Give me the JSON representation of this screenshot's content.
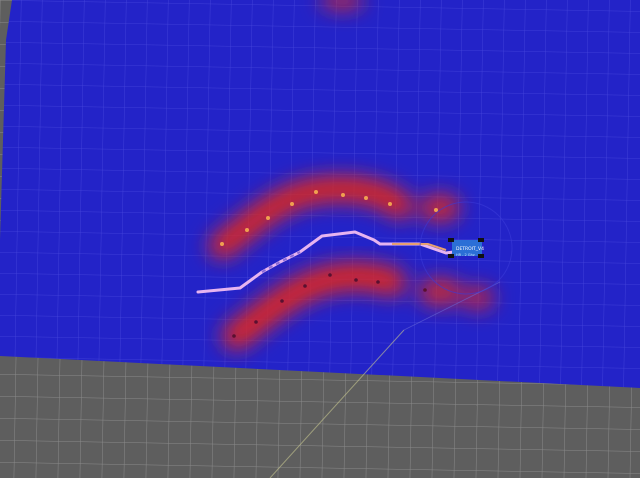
{
  "viewer": {
    "robot_label": "DETROIT_V4",
    "robot_sublabel": "HR - 2 Ghz",
    "colors": {
      "costmap_free": "#2323c8",
      "costmap_grid": "#5a5ae6",
      "costmap_lethal": "#e0281e",
      "floor": "#5e5e5e",
      "floor_grid": "#8a8a8a",
      "planned_path": "#e6b4f0",
      "local_path": "#e8a070",
      "robot_body": "#2b6fd6"
    },
    "icons": [
      "robot-icon"
    ]
  }
}
